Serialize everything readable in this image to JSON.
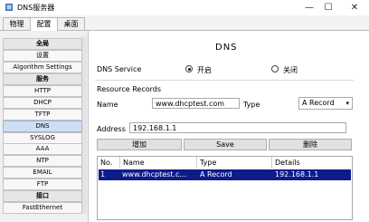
{
  "window": {
    "title": "DNS服务器",
    "minimize": "—",
    "maximize": "☐",
    "close": "✕"
  },
  "tabs": [
    {
      "label": "物理"
    },
    {
      "label": "配置"
    },
    {
      "label": "桌面"
    }
  ],
  "sidebar": {
    "items": [
      {
        "label": "全局",
        "header": true
      },
      {
        "label": "设置"
      },
      {
        "label": "Algorithm Settings"
      },
      {
        "label": "服务",
        "header": true
      },
      {
        "label": "HTTP"
      },
      {
        "label": "DHCP"
      },
      {
        "label": "TFTP"
      },
      {
        "label": "DNS",
        "selected": true
      },
      {
        "label": "SYSLOG"
      },
      {
        "label": "AAA"
      },
      {
        "label": "NTP"
      },
      {
        "label": "EMAIL"
      },
      {
        "label": "FTP"
      },
      {
        "label": "接口",
        "header": true
      },
      {
        "label": "FastEthernet"
      }
    ]
  },
  "dns": {
    "title": "DNS",
    "service_label": "DNS Service",
    "on_label": "开启",
    "off_label": "关闭",
    "service_state": "on",
    "resource_records_label": "Resource Records",
    "name_label": "Name",
    "name_value": "www.dhcptest.com",
    "type_label": "Type",
    "type_value": "A Record",
    "address_label": "Address",
    "address_value": "192.168.1.1",
    "add_button": "增加",
    "save_button": "Save",
    "delete_button": "删除"
  },
  "records_table": {
    "columns": [
      "No.",
      "Name",
      "Type",
      "Details"
    ],
    "rows": [
      {
        "no": "1",
        "name": "www.dhcptest.c...",
        "type": "A Record",
        "details": "192.168.1.1"
      }
    ]
  }
}
